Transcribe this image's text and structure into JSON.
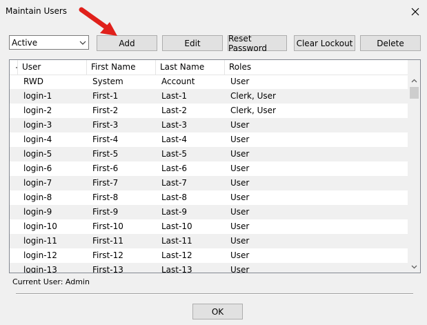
{
  "window": {
    "title": "Maintain Users"
  },
  "filter": {
    "selected": "Active"
  },
  "toolbar": {
    "add_label": "Add",
    "edit_label": "Edit",
    "reset_password_label": "Reset Password",
    "clear_lockout_label": "Clear Lockout",
    "delete_label": "Delete"
  },
  "grid": {
    "columns": [
      "User",
      "First Name",
      "Last Name",
      "Roles"
    ],
    "rows": [
      [
        "RWD",
        "System",
        "Account",
        "User"
      ],
      [
        "login-1",
        "First-1",
        "Last-1",
        "Clerk, User"
      ],
      [
        "login-2",
        "First-2",
        "Last-2",
        "Clerk, User"
      ],
      [
        "login-3",
        "First-3",
        "Last-3",
        "User"
      ],
      [
        "login-4",
        "First-4",
        "Last-4",
        "User"
      ],
      [
        "login-5",
        "First-5",
        "Last-5",
        "User"
      ],
      [
        "login-6",
        "First-6",
        "Last-6",
        "User"
      ],
      [
        "login-7",
        "First-7",
        "Last-7",
        "User"
      ],
      [
        "login-8",
        "First-8",
        "Last-8",
        "User"
      ],
      [
        "login-9",
        "First-9",
        "Last-9",
        "User"
      ],
      [
        "login-10",
        "First-10",
        "Last-10",
        "User"
      ],
      [
        "login-11",
        "First-11",
        "Last-11",
        "User"
      ],
      [
        "login-12",
        "First-12",
        "Last-12",
        "User"
      ],
      [
        "login-13",
        "First-13",
        "Last-13",
        "User"
      ]
    ]
  },
  "status": {
    "current_user": "Current User: Admin"
  },
  "footer": {
    "ok_label": "OK"
  },
  "icons": {
    "close": "close-icon",
    "dropdown": "chevron-down-icon",
    "scroll_up": "chevron-up-icon",
    "scroll_down": "chevron-down-icon",
    "annotation": "red-arrow-icon"
  },
  "colors": {
    "annotation_arrow": "#e0201b",
    "alt_row": "#f0f0f0"
  }
}
